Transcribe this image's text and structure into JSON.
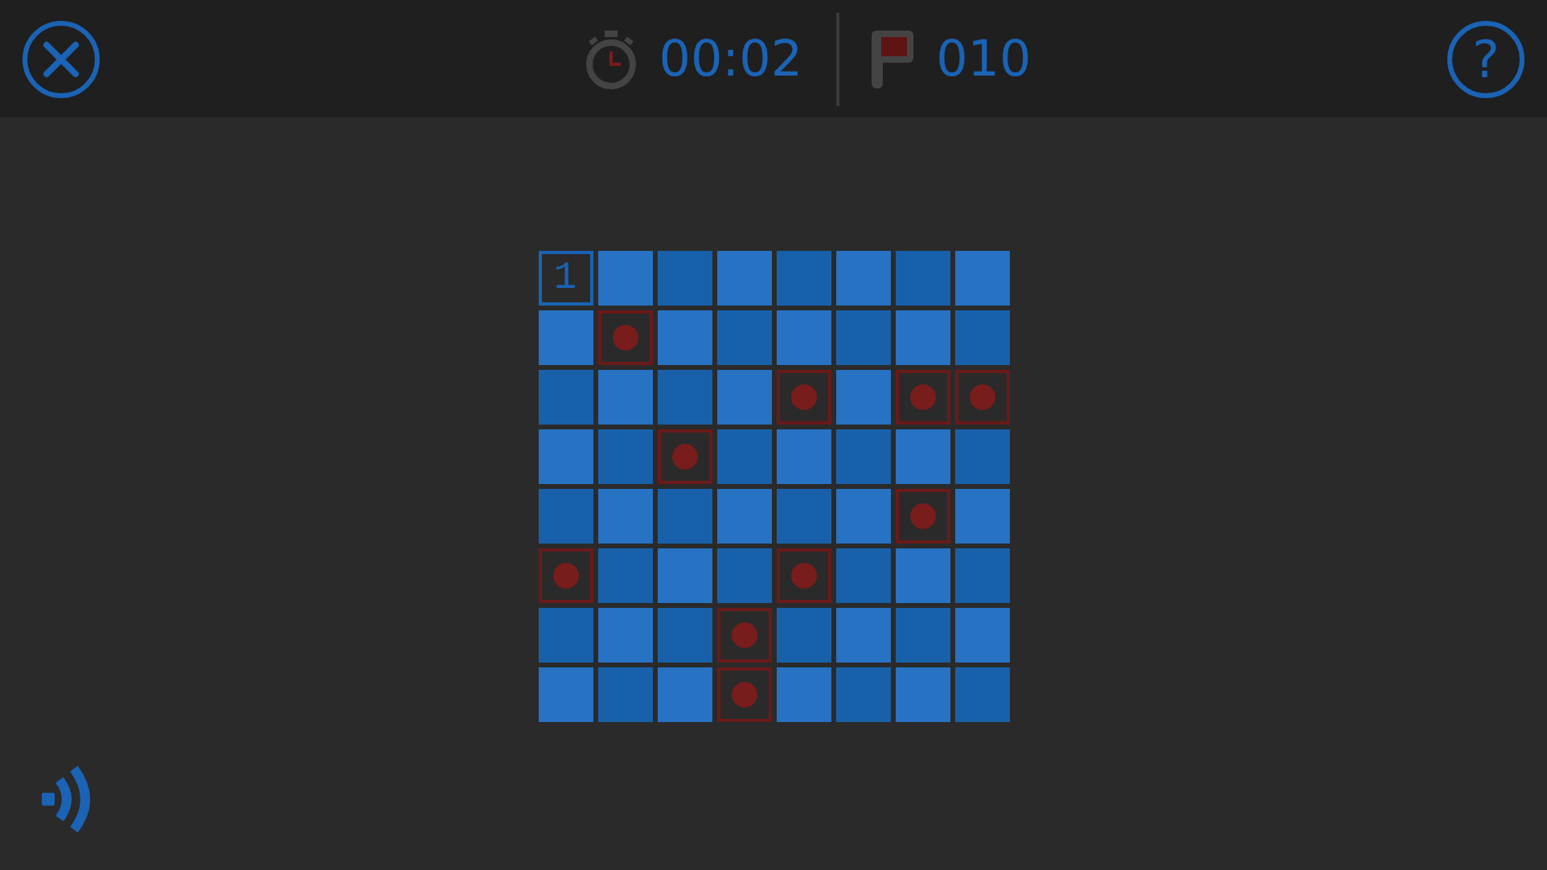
{
  "header": {
    "timer": "00:02",
    "flags": "010",
    "help": "?"
  },
  "board": {
    "rows": [
      [
        {
          "kind": "number",
          "text": "1"
        },
        {
          "kind": "hidden"
        },
        {
          "kind": "hidden"
        },
        {
          "kind": "hidden"
        },
        {
          "kind": "hidden"
        },
        {
          "kind": "hidden"
        },
        {
          "kind": "hidden"
        },
        {
          "kind": "hidden"
        }
      ],
      [
        {
          "kind": "hidden"
        },
        {
          "kind": "mine"
        },
        {
          "kind": "hidden"
        },
        {
          "kind": "hidden"
        },
        {
          "kind": "hidden"
        },
        {
          "kind": "hidden"
        },
        {
          "kind": "hidden"
        },
        {
          "kind": "hidden"
        }
      ],
      [
        {
          "kind": "hidden"
        },
        {
          "kind": "hidden"
        },
        {
          "kind": "hidden"
        },
        {
          "kind": "hidden"
        },
        {
          "kind": "mine"
        },
        {
          "kind": "hidden"
        },
        {
          "kind": "mine"
        },
        {
          "kind": "mine"
        }
      ],
      [
        {
          "kind": "hidden"
        },
        {
          "kind": "hidden"
        },
        {
          "kind": "mine"
        },
        {
          "kind": "hidden"
        },
        {
          "kind": "hidden"
        },
        {
          "kind": "hidden"
        },
        {
          "kind": "hidden"
        },
        {
          "kind": "hidden"
        }
      ],
      [
        {
          "kind": "hidden"
        },
        {
          "kind": "hidden"
        },
        {
          "kind": "hidden"
        },
        {
          "kind": "hidden"
        },
        {
          "kind": "hidden"
        },
        {
          "kind": "hidden"
        },
        {
          "kind": "mine"
        },
        {
          "kind": "hidden"
        }
      ],
      [
        {
          "kind": "mine"
        },
        {
          "kind": "hidden"
        },
        {
          "kind": "hidden"
        },
        {
          "kind": "hidden"
        },
        {
          "kind": "mine"
        },
        {
          "kind": "hidden"
        },
        {
          "kind": "hidden"
        },
        {
          "kind": "hidden"
        }
      ],
      [
        {
          "kind": "hidden"
        },
        {
          "kind": "hidden"
        },
        {
          "kind": "hidden"
        },
        {
          "kind": "mine"
        },
        {
          "kind": "hidden"
        },
        {
          "kind": "hidden"
        },
        {
          "kind": "hidden"
        },
        {
          "kind": "hidden"
        }
      ],
      [
        {
          "kind": "hidden"
        },
        {
          "kind": "hidden"
        },
        {
          "kind": "hidden"
        },
        {
          "kind": "mine"
        },
        {
          "kind": "hidden"
        },
        {
          "kind": "hidden"
        },
        {
          "kind": "hidden"
        },
        {
          "kind": "hidden"
        }
      ]
    ]
  }
}
